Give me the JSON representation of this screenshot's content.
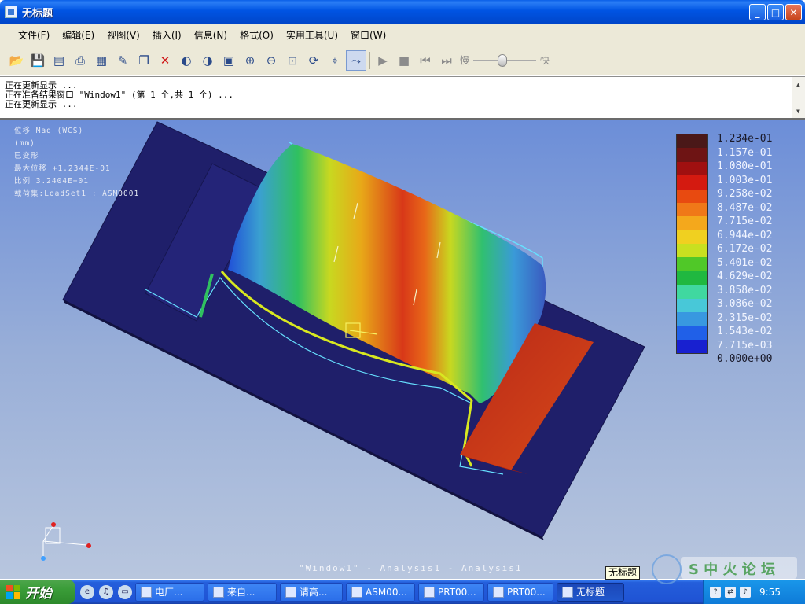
{
  "window": {
    "title": "无标题",
    "minimize_icon": "minimize-icon",
    "maximize_icon": "maximize-icon",
    "close_icon": "close-icon"
  },
  "menu": {
    "items": [
      "文件(F)",
      "编辑(E)",
      "视图(V)",
      "插入(I)",
      "信息(N)",
      "格式(O)",
      "实用工具(U)",
      "窗口(W)"
    ]
  },
  "toolbar": {
    "speed_slow": "慢",
    "speed_fast": "快",
    "speed_level": 0.45
  },
  "messages": {
    "lines": [
      "正在更新显示 ...",
      "正在准备结果窗口 \"Window1\" (第 1 个,共 1 个) ...",
      "正在更新显示 ..."
    ]
  },
  "viewport": {
    "info": [
      "位移 Mag (WCS)",
      "(mm)",
      "已变形",
      "最大位移  +1.2344E-01",
      "比例  3.2404E+01",
      "载荷集:LoadSet1 : ASM0001"
    ],
    "window_label": "\"Window1\" - Analysis1 - Analysis1"
  },
  "legend": {
    "labels": [
      "1.234e-01",
      "1.157e-01",
      "1.080e-01",
      "1.003e-01",
      "9.258e-02",
      "8.487e-02",
      "7.715e-02",
      "6.944e-02",
      "6.172e-02",
      "5.401e-02",
      "4.629e-02",
      "3.858e-02",
      "3.086e-02",
      "2.315e-02",
      "1.543e-02",
      "7.715e-03",
      "0.000e+00"
    ],
    "colors": [
      "#4a1818",
      "#6e1414",
      "#a01010",
      "#d41a10",
      "#e84a10",
      "#f07818",
      "#f4a81c",
      "#f0d020",
      "#c8e020",
      "#50c828",
      "#20b840",
      "#40d8a0",
      "#48c8d8",
      "#3898e0",
      "#2060e8",
      "#1820d0"
    ]
  },
  "taskbar": {
    "start_label": "开始",
    "tasks": [
      "电厂...",
      "来自...",
      "请高...",
      "ASM00...",
      "PRT00...",
      "PRT00...",
      "无标题"
    ],
    "clock": "9:55",
    "tooltip": "无标题"
  }
}
